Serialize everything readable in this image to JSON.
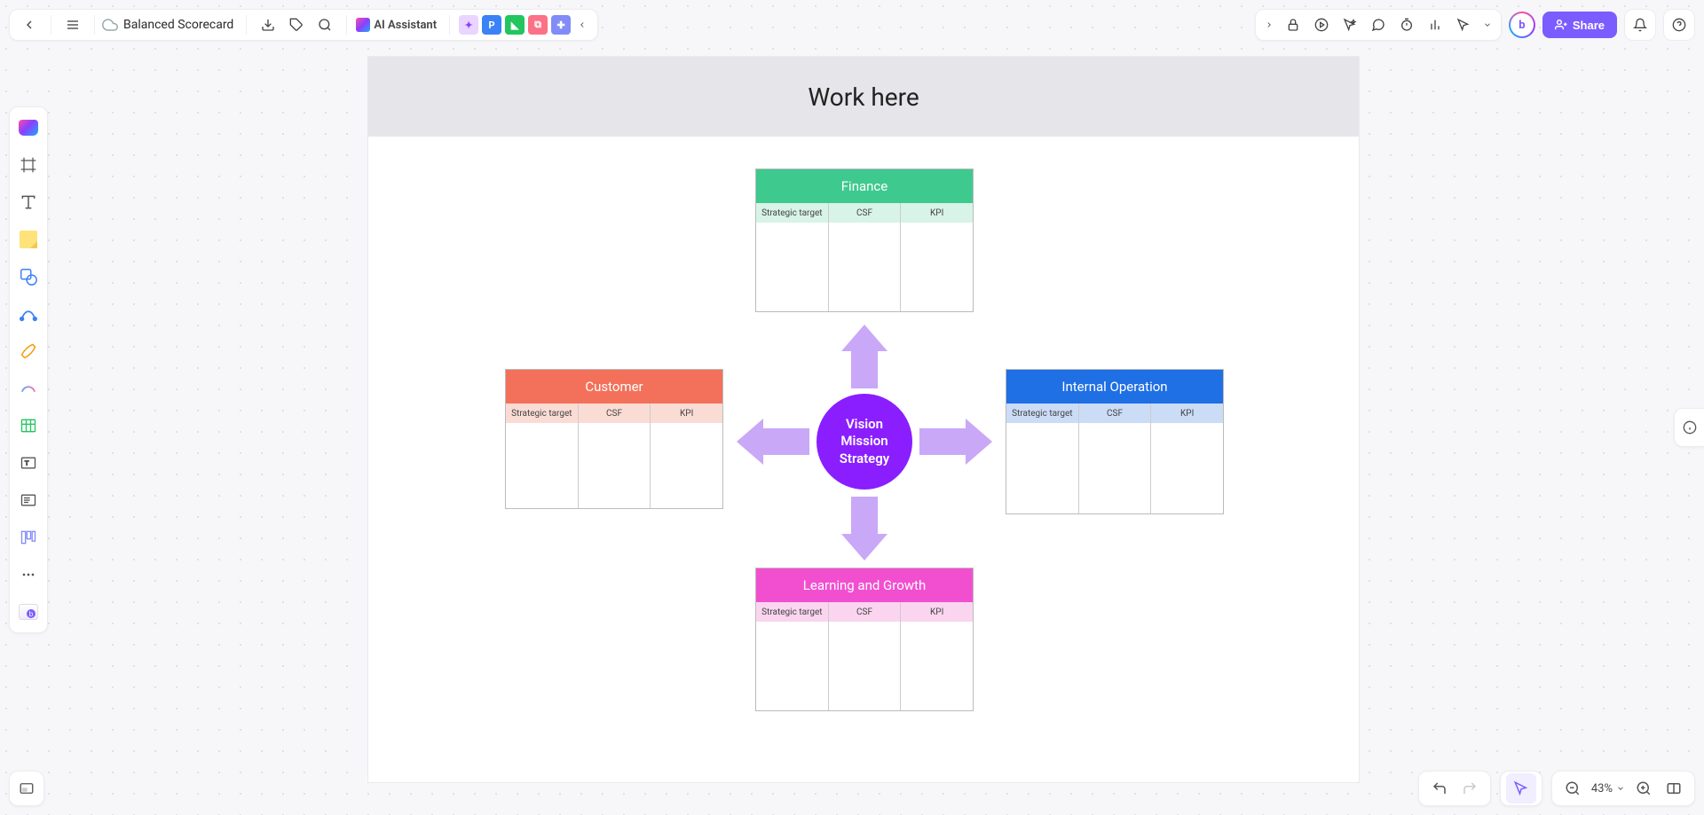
{
  "header": {
    "doc_title": "Balanced Scorecard",
    "ai_label": "AI Assistant",
    "avatars": [
      {
        "letter": "",
        "bg": "#e9d5ff"
      },
      {
        "letter": "P",
        "bg": "#3b82f6"
      },
      {
        "letter": "",
        "bg": "#22c55e"
      },
      {
        "letter": "",
        "bg": "#fb7185"
      },
      {
        "letter": "",
        "bg": "#818cf8"
      }
    ],
    "share_label": "Share",
    "user_initial": "b"
  },
  "board": {
    "frame_title": "Work here",
    "center": {
      "line1": "Vision",
      "line2": "Mission",
      "line3": "Strategy"
    },
    "columns": {
      "c1": "Strategic target",
      "c2": "CSF",
      "c3": "KPI"
    },
    "perspectives": {
      "finance": {
        "title": "Finance",
        "head_bg": "#3ec98e",
        "sub_bg": "#d8f3e7"
      },
      "customer": {
        "title": "Customer",
        "head_bg": "#f3715a",
        "sub_bg": "#fbdcd5"
      },
      "internal": {
        "title": "Internal Operation",
        "head_bg": "#1f6fe5",
        "sub_bg": "#cbdcf7"
      },
      "learning": {
        "title": "Learning and Growth",
        "head_bg": "#f24fd0",
        "sub_bg": "#fbd5f0"
      }
    }
  },
  "footer": {
    "zoom": "43%"
  }
}
